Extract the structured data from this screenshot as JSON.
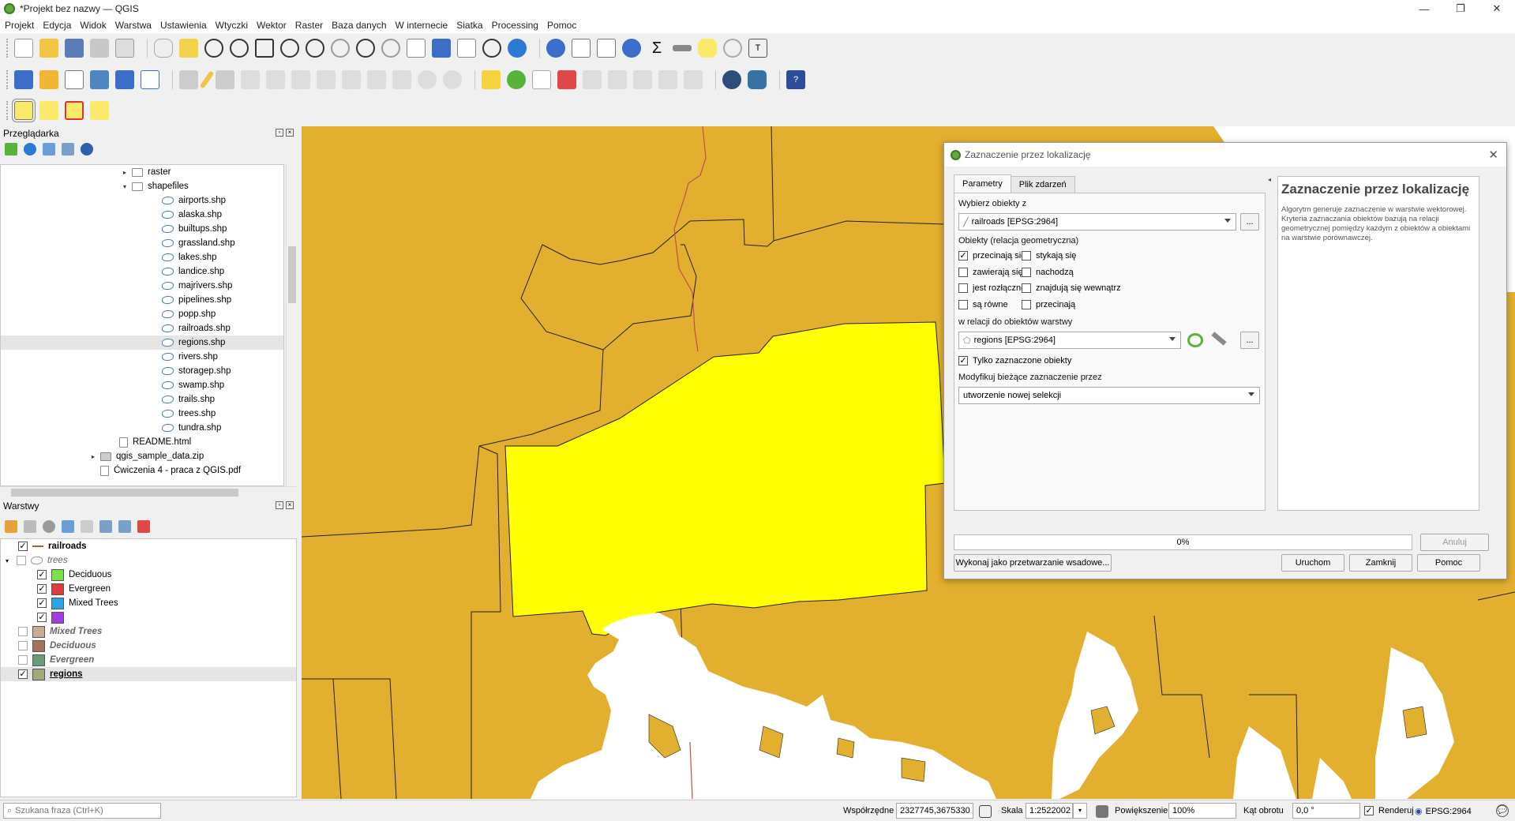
{
  "window": {
    "title": "*Projekt bez nazwy — QGIS"
  },
  "menu": [
    "Projekt",
    "Edycja",
    "Widok",
    "Warstwa",
    "Ustawienia",
    "Wtyczki",
    "Wektor",
    "Raster",
    "Baza danych",
    "W internecie",
    "Siatka",
    "Processing",
    "Pomoc"
  ],
  "browser": {
    "title": "Przeglądarka",
    "items": [
      {
        "label": "raster",
        "kind": "folder",
        "indent": 1,
        "arrow": "▸"
      },
      {
        "label": "shapefiles",
        "kind": "folder",
        "indent": 1,
        "arrow": "▾"
      },
      {
        "label": "airports.shp",
        "kind": "shp",
        "indent": 2
      },
      {
        "label": "alaska.shp",
        "kind": "shp",
        "indent": 2
      },
      {
        "label": "builtups.shp",
        "kind": "shp",
        "indent": 2
      },
      {
        "label": "grassland.shp",
        "kind": "shp",
        "indent": 2
      },
      {
        "label": "lakes.shp",
        "kind": "shp",
        "indent": 2
      },
      {
        "label": "landice.shp",
        "kind": "shp",
        "indent": 2
      },
      {
        "label": "majrivers.shp",
        "kind": "shp",
        "indent": 2
      },
      {
        "label": "pipelines.shp",
        "kind": "shp",
        "indent": 2
      },
      {
        "label": "popp.shp",
        "kind": "shp",
        "indent": 2
      },
      {
        "label": "railroads.shp",
        "kind": "shp",
        "indent": 2
      },
      {
        "label": "regions.shp",
        "kind": "shp",
        "indent": 2,
        "selected": true
      },
      {
        "label": "rivers.shp",
        "kind": "shp",
        "indent": 2
      },
      {
        "label": "storagep.shp",
        "kind": "shp",
        "indent": 2
      },
      {
        "label": "swamp.shp",
        "kind": "shp",
        "indent": 2
      },
      {
        "label": "trails.shp",
        "kind": "shp",
        "indent": 2
      },
      {
        "label": "trees.shp",
        "kind": "shp",
        "indent": 2
      },
      {
        "label": "tundra.shp",
        "kind": "shp",
        "indent": 2
      },
      {
        "label": "README.html",
        "kind": "file",
        "indent": 1
      },
      {
        "label": "qgis_sample_data.zip",
        "kind": "zip",
        "indent": 0,
        "arrow": "▸"
      },
      {
        "label": "Ćwiczenia 4 - praca z QGIS.pdf",
        "kind": "file",
        "indent": 0
      }
    ]
  },
  "layers": {
    "title": "Warstwy",
    "items": [
      {
        "label": "railroads",
        "indent": 0,
        "checked": true,
        "bold": true,
        "sym": "line"
      },
      {
        "label": "trees",
        "indent": 0,
        "checked": false,
        "italic": true,
        "sym": "group",
        "arrow": "▾"
      },
      {
        "label": "Deciduous",
        "indent": 1,
        "checked": true,
        "color": "#79e24b"
      },
      {
        "label": "Evergreen",
        "indent": 1,
        "checked": true,
        "color": "#e23b3b"
      },
      {
        "label": "Mixed Trees",
        "indent": 1,
        "checked": true,
        "color": "#2ba4e8"
      },
      {
        "label": "",
        "indent": 1,
        "checked": true,
        "color": "#a13be3"
      },
      {
        "label": "Mixed Trees",
        "indent": 0,
        "checked": false,
        "italic": true,
        "bold": true,
        "color": "#c9ac8f"
      },
      {
        "label": "Deciduous",
        "indent": 0,
        "checked": false,
        "italic": true,
        "bold": true,
        "color": "#a5725c"
      },
      {
        "label": "Evergreen",
        "indent": 0,
        "checked": false,
        "italic": true,
        "bold": true,
        "color": "#6b9c7a"
      },
      {
        "label": "regions",
        "indent": 0,
        "checked": true,
        "bold": true,
        "underline": true,
        "color": "#a5a87a",
        "selected": true
      }
    ]
  },
  "dialog": {
    "title": "Zaznaczenie przez lokalizację",
    "tabs": [
      "Parametry",
      "Plik zdarzeń"
    ],
    "select_from_label": "Wybierz obiekty z",
    "select_from_value": "railroads [EPSG:2964]",
    "predicate_label": "Obiekty (relacja geometryczna)",
    "predicates": [
      {
        "label": "przecinają się",
        "checked": true
      },
      {
        "label": "stykają się",
        "checked": false
      },
      {
        "label": "zawierają się",
        "checked": false
      },
      {
        "label": "nachodzą",
        "checked": false
      },
      {
        "label": "jest rozłączne",
        "checked": false
      },
      {
        "label": "znajdują się wewnątrz",
        "checked": false
      },
      {
        "label": "są równe",
        "checked": false
      },
      {
        "label": "przecinają",
        "checked": false
      }
    ],
    "compare_label": "w relacji do obiektów warstwy",
    "compare_value": "regions [EPSG:2964]",
    "selected_only_label": "Tylko zaznaczone obiekty",
    "modify_label": "Modyfikuj bieżące zaznaczenie przez",
    "modify_value": "utworzenie nowej selekcji",
    "ellipsis": "...",
    "help_title": "Zaznaczenie przez lokalizację",
    "help_text": "Algorytm generuje zaznaczenie w warstwie wektorowej. Kryteria zaznaczania obiektów bazują na relacji geometrycznej pomiędzy każdym z obiektów a obiektami na warstwie porównawczej.",
    "progress": "0%",
    "progress_value": 0,
    "cancel": "Anuluj",
    "batch": "Wykonaj jako przetwarzanie wsadowe...",
    "run": "Uruchom",
    "close": "Zamknij",
    "help": "Pomoc"
  },
  "statusbar": {
    "search_placeholder": "Szukana fraza (Ctrl+K)",
    "coord_label": "Współrzędne",
    "coord_value": "2327745,3675330",
    "scale_label": "Skala",
    "scale_value": "1:2522002",
    "mag_label": "Powiększenie",
    "mag_value": "100%",
    "rot_label": "Kąt obrotu",
    "rot_value": "0,0 °",
    "render_label": "Renderuj",
    "crs": "EPSG:2964"
  },
  "colors": {
    "map_fill": "#e3af2f",
    "selected": "#ffff00",
    "water": "#ffffff",
    "rail": "#c0504d"
  }
}
